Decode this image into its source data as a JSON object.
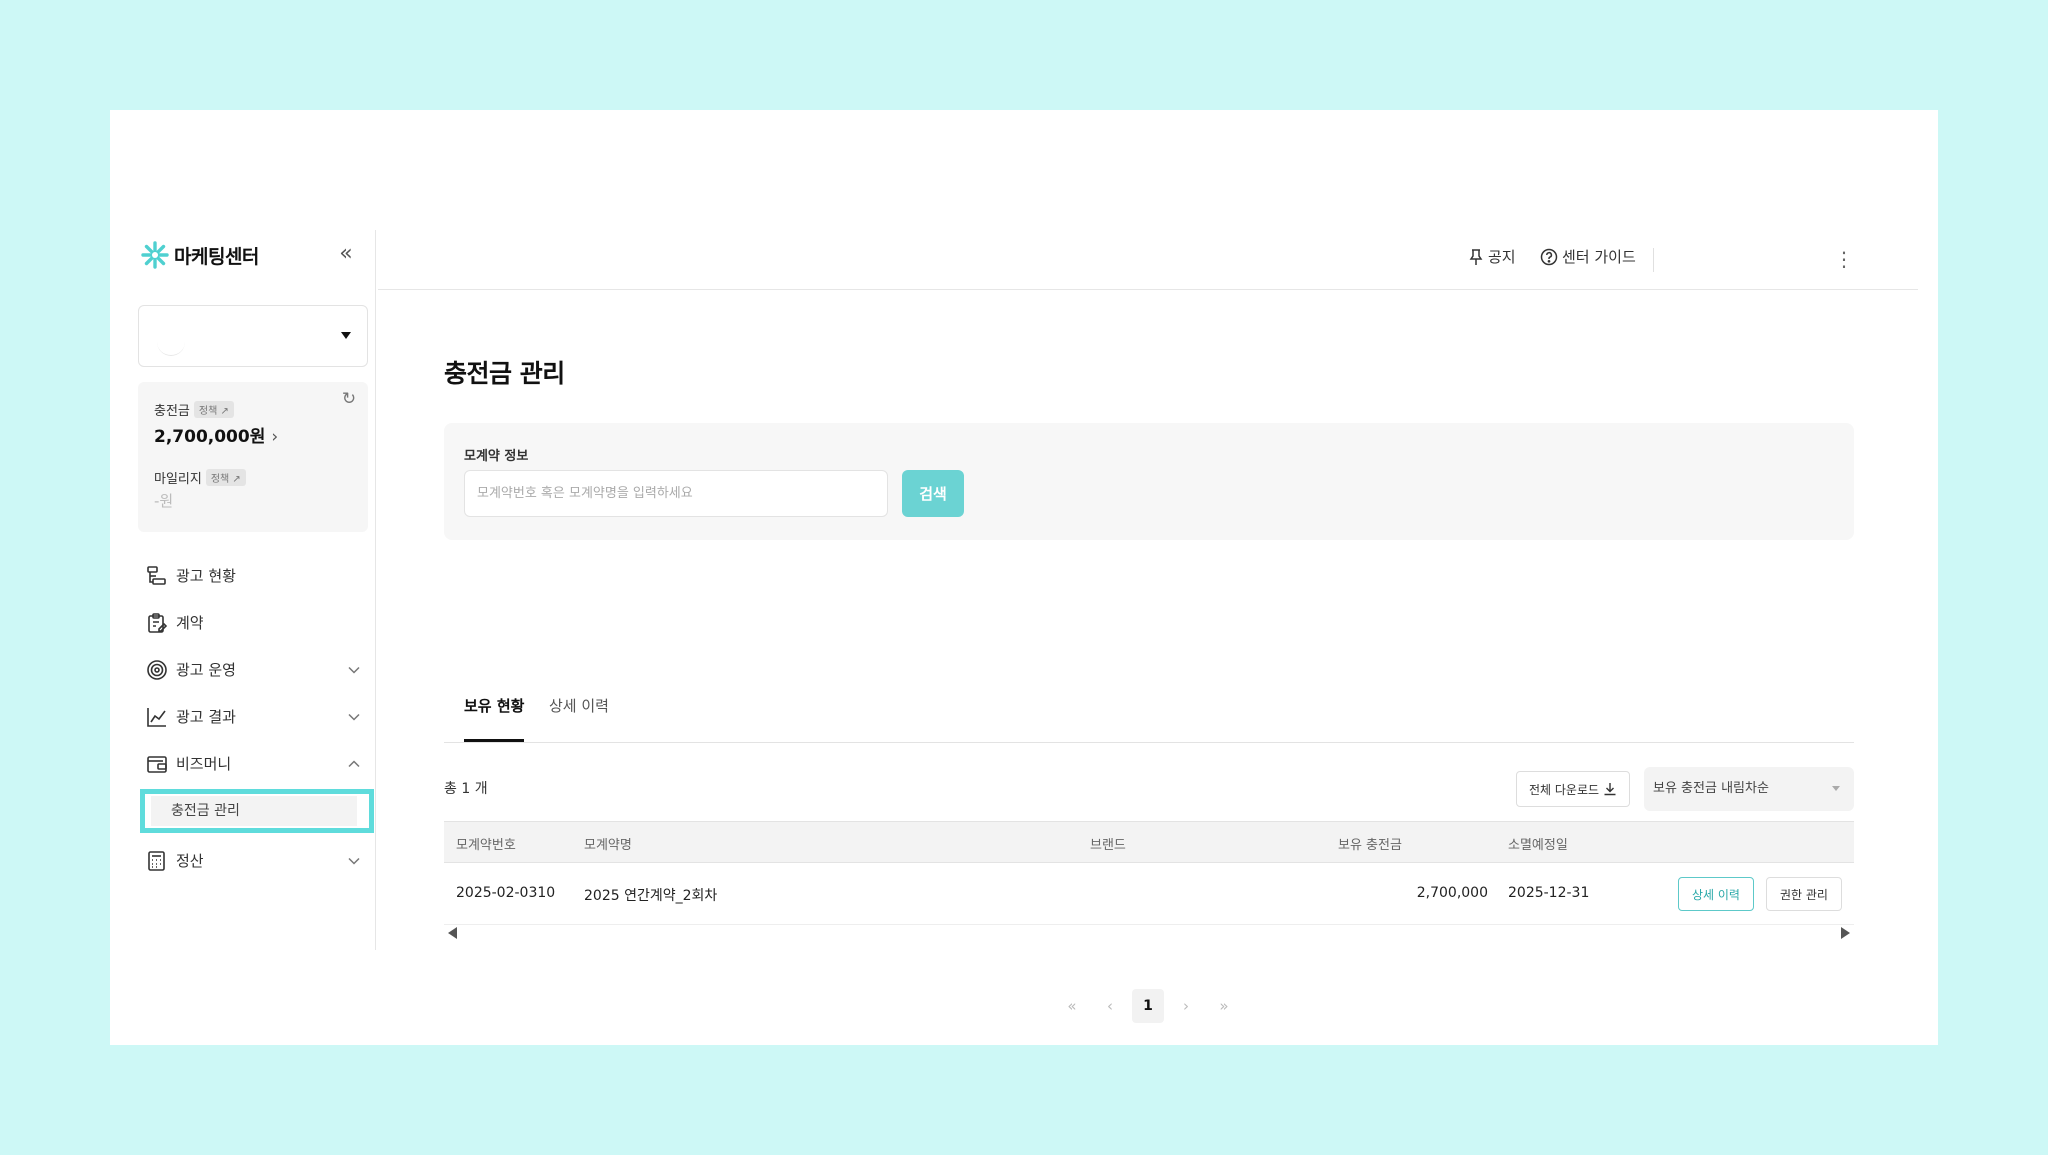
{
  "app": {
    "name": "마케팅센터",
    "collapse_icon": "double-chevron-left-icon"
  },
  "balance": {
    "charge_label": "충전금",
    "charge_policy_tag": "정책 ↗",
    "charge_value": "2,700,000원",
    "mileage_label": "마일리지",
    "mileage_policy_tag": "정책 ↗",
    "mileage_value": "-원"
  },
  "nav": {
    "items": [
      {
        "label": "광고 현황",
        "icon": "ad-status-icon"
      },
      {
        "label": "계약",
        "icon": "clipboard-icon"
      },
      {
        "label": "광고 운영",
        "icon": "target-icon"
      },
      {
        "label": "광고 결과",
        "icon": "chart-line-icon"
      },
      {
        "label": "비즈머니",
        "icon": "wallet-icon"
      },
      {
        "label": "정산",
        "icon": "calculator-icon"
      }
    ],
    "sub_active": "충전금 관리"
  },
  "header": {
    "notice": "공지",
    "guide": "센터 가이드"
  },
  "page": {
    "title": "충전금 관리"
  },
  "search": {
    "label": "모계약 정보",
    "placeholder": "모계약번호 혹은 모계약명을 입력하세요",
    "value": "",
    "button": "검색"
  },
  "tabs": [
    {
      "label": "보유 현황",
      "active": true
    },
    {
      "label": "상세 이력",
      "active": false
    }
  ],
  "list": {
    "total": "총 1 개",
    "download_button": "전체 다운로드",
    "sort_selected": "보유 충전금 내림차순"
  },
  "table": {
    "headers": [
      "모계약번호",
      "모계약명",
      "브랜드",
      "보유 충전금",
      "소멸예정일"
    ],
    "rows": [
      {
        "contract_no": "2025-02-0310",
        "contract_name": "2025 연간계약_2회차",
        "brand": "",
        "balance": "2,700,000",
        "expiry": "2025-12-31",
        "detail_button": "상세 이력",
        "perm_button": "권한 관리"
      }
    ]
  },
  "pagination": {
    "current": "1"
  },
  "colors": {
    "background": "#cdf8f6",
    "accent": "#6bd3d3",
    "highlight_border": "#5fdcdc"
  }
}
